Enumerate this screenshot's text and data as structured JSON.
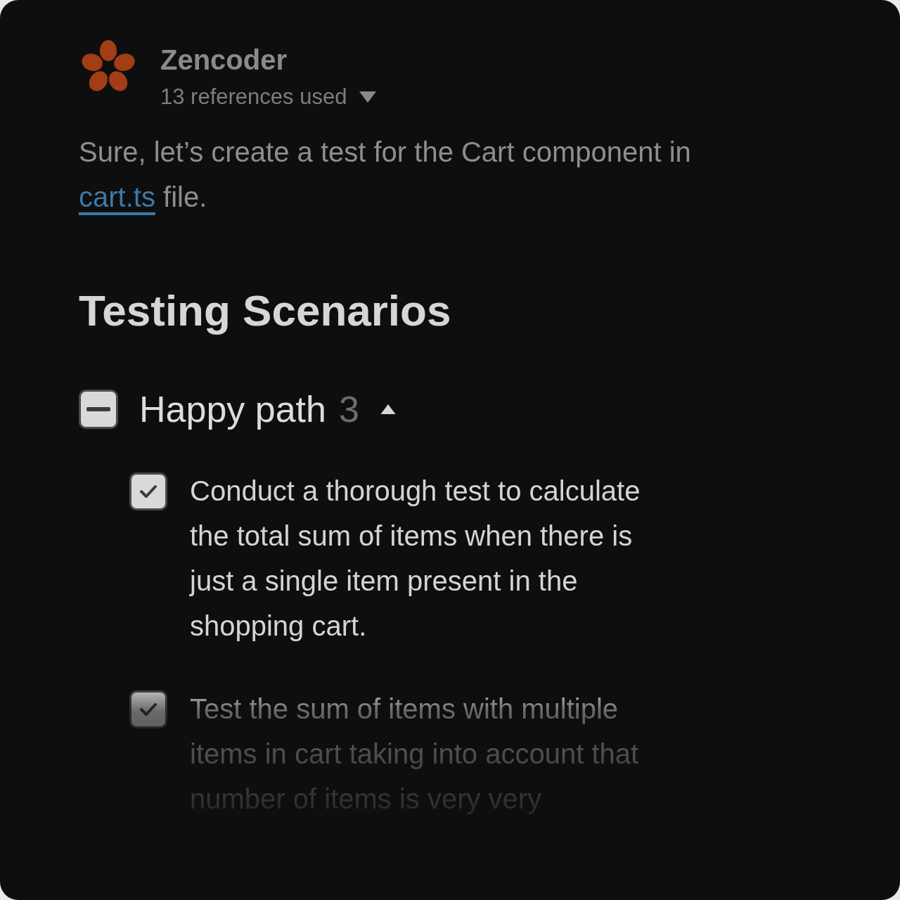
{
  "assistant": {
    "name": "Zencoder",
    "references": "13 references used",
    "references_expanded": false
  },
  "message": {
    "before": "Sure, let’s create a test for the Cart component in",
    "link": "cart.ts",
    "after": "file."
  },
  "heading": "Testing Scenarios",
  "group": {
    "title": "Happy path",
    "count": "3",
    "indeterminate": true,
    "expanded": true,
    "items": [
      {
        "text": "Conduct a thorough test to calculate the total sum of items when there is just a single item present in the shopping cart.",
        "checked": true
      },
      {
        "text": "Test the sum of items with multiple items in cart taking into account that number of items is very very",
        "checked": true
      }
    ]
  }
}
